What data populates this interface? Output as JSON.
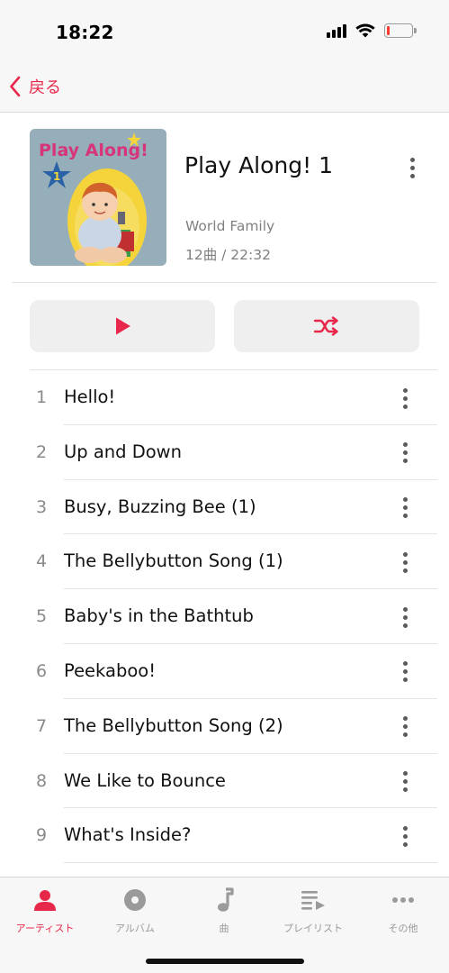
{
  "status_bar": {
    "time": "18:22",
    "battery_level": 0.12,
    "battery_color": "#ff3b30"
  },
  "nav": {
    "back_label": "戻る"
  },
  "album": {
    "title": "Play Along! 1",
    "artist": "World Family",
    "meta": "12曲 / 22:32",
    "artwork_text": "Play Along!",
    "artwork_number": "1"
  },
  "controls": {
    "play_icon": "play-icon",
    "shuffle_icon": "shuffle-icon"
  },
  "tracks": [
    {
      "number": "1",
      "title": "Hello!"
    },
    {
      "number": "2",
      "title": "Up and Down"
    },
    {
      "number": "3",
      "title": "Busy, Buzzing Bee (1)"
    },
    {
      "number": "4",
      "title": "The Bellybutton Song (1)"
    },
    {
      "number": "5",
      "title": "Baby's in the Bathtub"
    },
    {
      "number": "6",
      "title": "Peekaboo!"
    },
    {
      "number": "7",
      "title": "The Bellybutton Song (2)"
    },
    {
      "number": "8",
      "title": "We Like to Bounce"
    },
    {
      "number": "9",
      "title": "What's Inside?"
    }
  ],
  "tabs": [
    {
      "label": "アーティスト",
      "icon": "person-icon",
      "active": true
    },
    {
      "label": "アルバム",
      "icon": "album-icon",
      "active": false
    },
    {
      "label": "曲",
      "icon": "music-note-icon",
      "active": false
    },
    {
      "label": "プレイリスト",
      "icon": "playlist-icon",
      "active": false
    },
    {
      "label": "その他",
      "icon": "more-icon",
      "active": false
    }
  ],
  "colors": {
    "accent": "#e8284a",
    "secondary_text": "#808080",
    "button_bg": "#efeff0"
  }
}
